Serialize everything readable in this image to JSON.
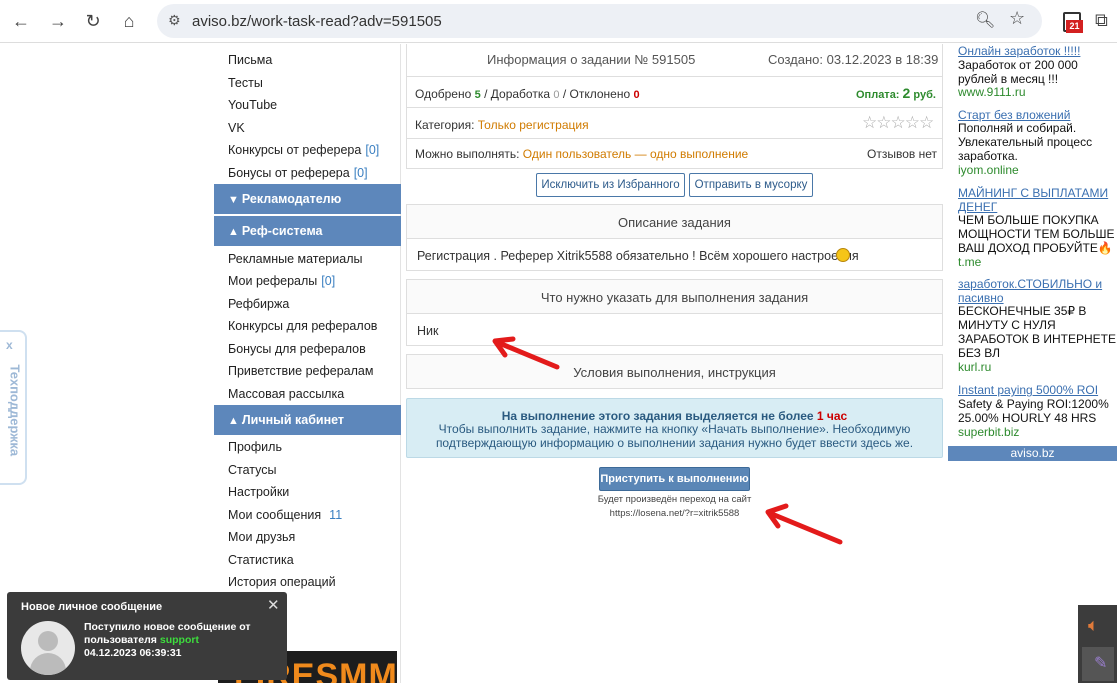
{
  "browser": {
    "url": "aviso.bz/work-task-read?adv=591505",
    "badge": "21"
  },
  "sidebar": {
    "items_top": [
      {
        "label": "Письма"
      },
      {
        "label": "Тесты"
      },
      {
        "label": "YouTube"
      },
      {
        "label": "VK"
      },
      {
        "label": "Конкурсы от реферера",
        "count": "[0]"
      },
      {
        "label": "Бонусы от реферера",
        "count": "[0]"
      }
    ],
    "header_advertiser": "Рекламодателю",
    "header_ref": "Реф-система",
    "items_ref": [
      {
        "label": "Рекламные материалы"
      },
      {
        "label": "Мои рефералы",
        "count": "[0]"
      },
      {
        "label": "Рефбиржа"
      },
      {
        "label": "Конкурсы для рефералов"
      },
      {
        "label": "Бонусы для рефералов"
      },
      {
        "label": "Приветствие рефералам"
      },
      {
        "label": "Массовая рассылка"
      }
    ],
    "header_cabinet": "Личный кабинет",
    "items_cabinet": [
      {
        "label": "Профиль"
      },
      {
        "label": "Статусы"
      },
      {
        "label": "Настройки"
      },
      {
        "label": "Мои сообщения",
        "count": "11"
      },
      {
        "label": "Мои друзья"
      },
      {
        "label": "Статистика"
      },
      {
        "label": "История операций"
      }
    ],
    "banner_text": "FIRESMM"
  },
  "task": {
    "header": "Информация о задании № 591505",
    "created": "Создано: 03.12.2023 в 18:39",
    "approved_label": "Одобрено",
    "approved": "5",
    "rework_label": "Доработка",
    "rework": "0",
    "rejected_label": "Отклонено",
    "rejected": "0",
    "payment_label": "Оплата:",
    "payment_value": "2",
    "payment_unit": "руб.",
    "category_label": "Категория:",
    "category": "Только регистрация",
    "can_do_label": "Можно выполнять:",
    "can_do": "Один пользователь — одно выполнение",
    "reviews": "Отзывов нет",
    "exclude_fav": "Исключить из Избранного",
    "send_trash": "Отправить в мусорку",
    "desc_title": "Описание задания",
    "desc_text": "Регистрация . Реферер Xitrik5588 обязательно ! Всём хорошего настроения",
    "need_title": "Что нужно указать для выполнения задания",
    "need_text": "Ник",
    "conditions_title": "Условия выполнения, инструкция",
    "time_pre": "На выполнение этого задания выделяется не более",
    "time_value": "1 час",
    "time_line2": "Чтобы выполнить задание, нажмите на кнопку «Начать выполнение». Необходимую",
    "time_line3": "подтверждающую информацию о выполнении задания нужно будет ввести здесь же.",
    "start_button": "Приступить к выполнению",
    "redirect_label": "Будет произведён переход на сайт",
    "redirect_url": "https://losena.net/?r=xitrik5588"
  },
  "ads": [
    {
      "title": "Онлайн заработок !!!!!",
      "desc": "Заработок от 200 000 рублей в месяц !!!",
      "url": "www.9111.ru"
    },
    {
      "title": "Старт без вложений",
      "desc": "Пополняй и собирай. Увлекательный процесс заработка.",
      "url": "iyom.online"
    },
    {
      "title": "МАЙНИНГ С ВЫПЛАТАМИ ДЕНЕГ",
      "desc": "ЧЕМ БОЛЬШЕ ПОКУПКА МОЩНОСТИ ТЕМ БОЛЬШЕ ВАШ ДОХОД ПРОБУЙТЕ🔥",
      "url": "t.me"
    },
    {
      "title": "заработок.СТОБИЛЬНО и пасивно",
      "desc": "БЕСКОНЕЧНЫЕ 35₽ В МИНУТУ С НУЛЯ ЗАРАБОТОК В ИНТЕРНЕТЕ БЕЗ ВЛ",
      "url": "kurl.ru"
    },
    {
      "title": "Instant paying 5000% ROI",
      "desc": "Safety & Paying ROI:1200% 25.00% HOURLY 48 HRS",
      "url": "superbit.biz"
    }
  ],
  "ads_footer": "aviso.bz",
  "support_tab": "Техподдержка",
  "support_close": "x",
  "toast": {
    "title": "Новое личное сообщение",
    "line1": "Поступило новое сообщение от",
    "line2_pre": "пользователя",
    "user": "support",
    "time": "04.12.2023 06:39:31"
  },
  "colors": {
    "accent": "#5d87bb",
    "green": "#2e8b2e",
    "red": "#cc0000",
    "orange": "#d07b00"
  }
}
